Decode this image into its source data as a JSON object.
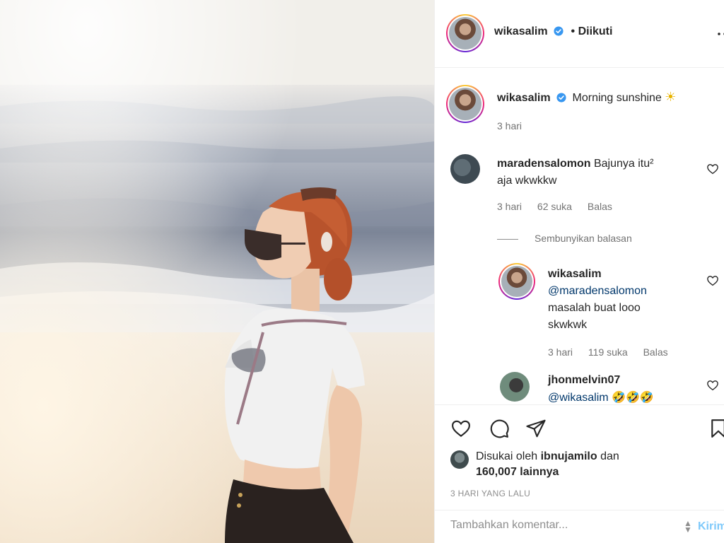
{
  "post": {
    "username": "wikasalim",
    "follow_status": "• Diikuti",
    "more_icon": "more-horizontal-icon",
    "verified_color": "#3897f0"
  },
  "caption": {
    "username": "wikasalim",
    "text": "Morning sunshine",
    "emoji": "☀",
    "time": "3 hari"
  },
  "comments": [
    {
      "username": "maradensalomon",
      "text_line1": "Bajunya itu²",
      "text_line2": "aja wkwkkw",
      "time": "3 hari",
      "likes": "62 suka",
      "reply": "Balas",
      "hide_replies": "Sembunyikan balasan",
      "replies": [
        {
          "username": "wikasalim",
          "mention": "@maradensalomon",
          "text_line1": "masalah buat looo",
          "text_line2": "skwkwk",
          "time": "3 hari",
          "likes": "119 suka",
          "reply": "Balas"
        }
      ]
    },
    {
      "username": "jhonmelvin07",
      "mention": "@wikasalim",
      "emoji": "🤣🤣🤣"
    }
  ],
  "actions": {
    "like_icon": "heart-icon",
    "comment_icon": "comment-icon",
    "share_icon": "send-icon",
    "save_icon": "bookmark-icon"
  },
  "likes": {
    "prefix": "Disukai oleh",
    "user": "ibnujamilo",
    "conjunction": "dan",
    "count": "160,007 lainnya"
  },
  "timestamp": "3 HARI YANG LALU",
  "comment_input": {
    "placeholder": "Tambahkan komentar...",
    "post_label": "Kirim"
  },
  "colors": {
    "link": "#0095f6",
    "mention": "#00376b",
    "muted": "#8e8e8e"
  }
}
